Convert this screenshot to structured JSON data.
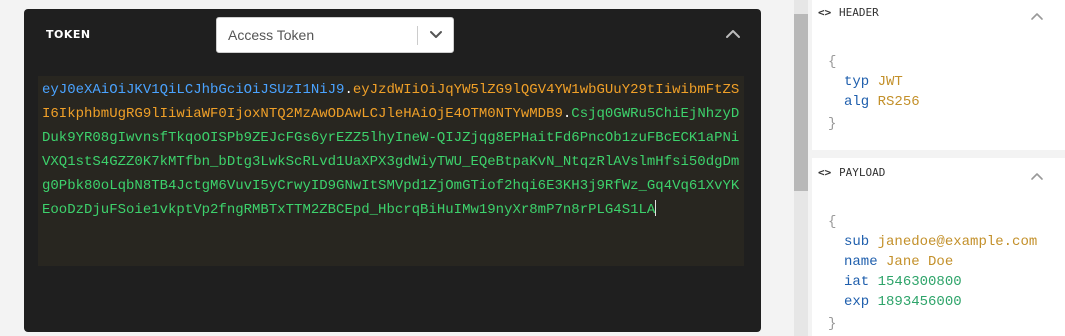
{
  "token_panel": {
    "title": "TOKEN",
    "algorithm_select": {
      "value": "Access Token"
    },
    "token": {
      "header": "eyJ0eXAiOiJKV1QiLCJhbGciOiJSUzI1NiJ9",
      "dot": ".",
      "payload": "eyJzdWIiOiJqYW5lZG9lQGV4YW1wbGUuY29tIiwibmFtZSI6IkphbmUgRG9lIiwiaWF0IjoxNTQ2MzAwODAwLCJleHAiOjE4OTM0NTYwMDB9",
      "signature": "Csjq0GWRu5ChiEjNhzyDDuk9YR08gIwvnsfTkqoOISPb9ZEJcFGs6yrEZZ5lhyIneW-QIJZjqg8EPHaitFd6PncOb1zuFBcECK1aPNiVXQ1stS4GZZ0K7kMTfbn_bDtg3LwkScRLvd1UaXPX3gdWiyTWU_EQeBtpaKvN_NtqzRlAVslmHfsi50dgDmg0Pbk80oLqbN8TB4JctgM6VuvI5yCrwyID9GNwItSMVpd1ZjOmGTiof2hqi6E3KH3j9RfWz_Gq4Vq61XvYKEooDzDjuFSoie1vkptVp2fngRMBTxTTM2ZBCEpd_HbcrqBiHuIMw19nyXr8mP7n8rPLG4S1LA"
    }
  },
  "right_panel": {
    "header": {
      "title": "HEADER",
      "icon": "code-icon",
      "fields": [
        {
          "key": "typ",
          "value": "JWT"
        },
        {
          "key": "alg",
          "value": "RS256"
        }
      ]
    },
    "payload": {
      "title": "PAYLOAD",
      "icon": "code-icon",
      "fields": [
        {
          "key": "sub",
          "value": "janedoe@example.com"
        },
        {
          "key": "name",
          "value": "Jane Doe"
        },
        {
          "key": "iat",
          "value": "1546300800"
        },
        {
          "key": "exp",
          "value": "1893456000"
        }
      ]
    },
    "code_icon_text": "<>",
    "open_brace": "{",
    "close_brace": "}"
  },
  "colors": {
    "token_header": "#4aa3ff",
    "token_payload": "#f0a028",
    "token_signature": "#3dd26c",
    "json_key": "#1f5fad",
    "json_string": "#c3902a",
    "json_number": "#2ea46a"
  }
}
